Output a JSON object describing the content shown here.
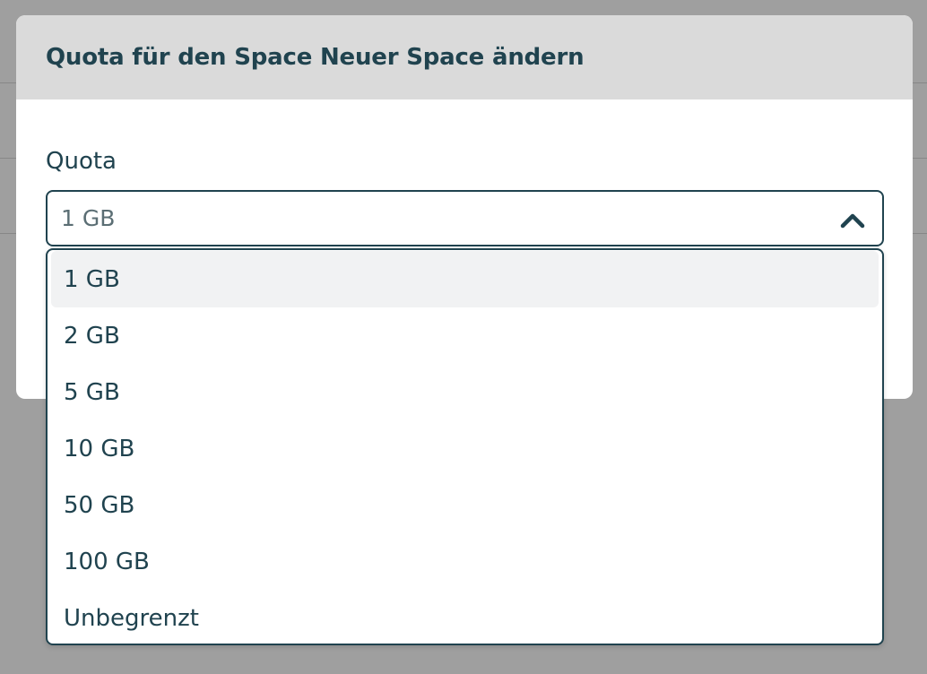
{
  "modal": {
    "title": "Quota für den Space Neuer Space ändern"
  },
  "quota_field": {
    "label": "Quota",
    "selected_value": "1 GB",
    "open": true,
    "options": [
      {
        "label": "1 GB",
        "highlighted": true
      },
      {
        "label": "2 GB",
        "highlighted": false
      },
      {
        "label": "5 GB",
        "highlighted": false
      },
      {
        "label": "10 GB",
        "highlighted": false
      },
      {
        "label": "50 GB",
        "highlighted": false
      },
      {
        "label": "100 GB",
        "highlighted": false
      },
      {
        "label": "Unbegrenzt",
        "highlighted": false
      }
    ]
  },
  "icons": {
    "dropdown_toggle": "chevron-up-icon"
  },
  "colors": {
    "text": "#20434f",
    "header_bg": "#dadada",
    "option_highlight": "#f1f2f3",
    "overlay": "#9a9a9a"
  }
}
